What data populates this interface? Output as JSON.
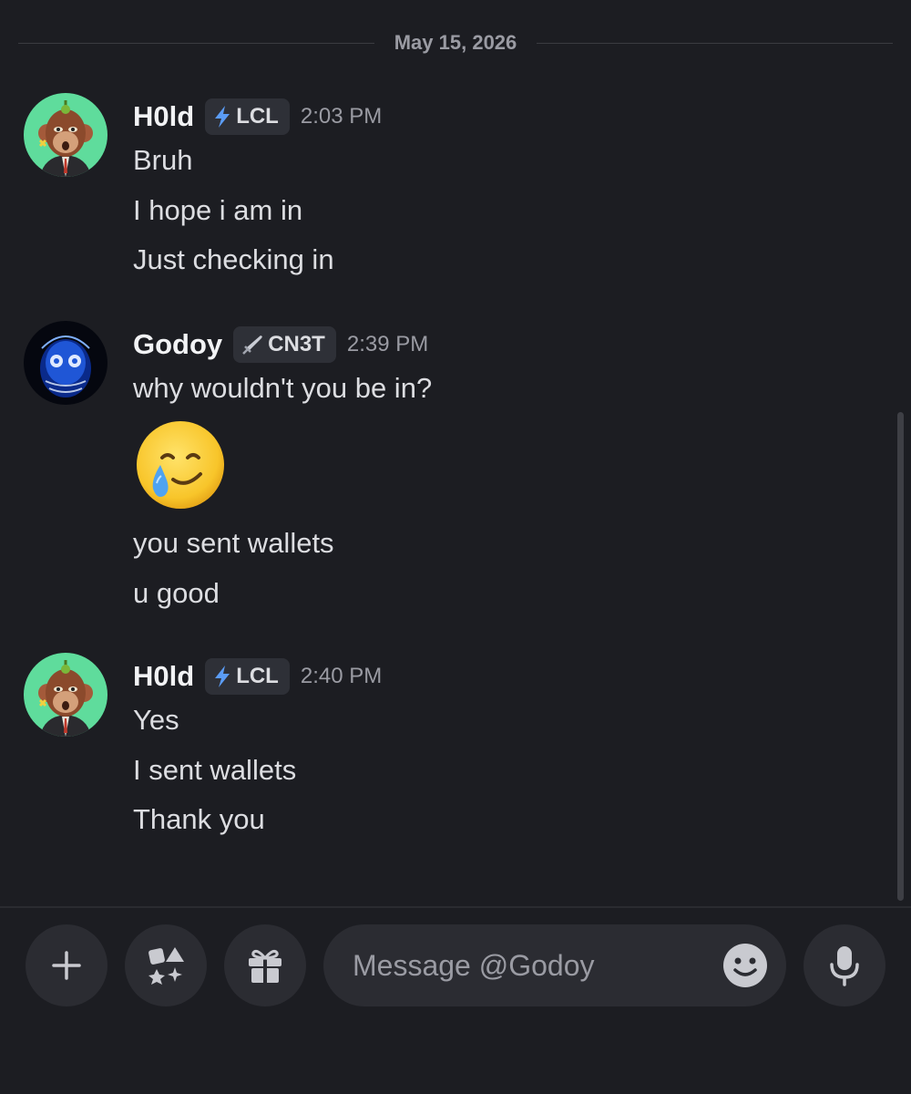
{
  "date_divider": "May 15, 2026",
  "messages": [
    {
      "username": "H0ld",
      "tag": "LCL",
      "tag_icon": "lightning-icon",
      "time": "2:03 PM",
      "lines": [
        "Bruh",
        "I hope i am in",
        "Just checking in"
      ]
    },
    {
      "username": "Godoy",
      "tag": "CN3T",
      "tag_icon": "sword-icon",
      "time": "2:39 PM",
      "lines": [
        "why wouldn't you be in?",
        "🥲",
        "you sent wallets",
        "u good"
      ]
    },
    {
      "username": "H0ld",
      "tag": "LCL",
      "tag_icon": "lightning-icon",
      "time": "2:40 PM",
      "lines": [
        "Yes",
        "I sent wallets",
        "Thank you"
      ]
    }
  ],
  "composer": {
    "placeholder": "Message @Godoy",
    "buttons": [
      "plus-icon",
      "apps-icon",
      "gift-icon",
      "emoji-icon",
      "microphone-icon"
    ]
  },
  "colors": {
    "background": "#1c1d22",
    "tag_lightning": "#5b9cf5",
    "avatar_hold_bg": "#5fdc9c"
  }
}
